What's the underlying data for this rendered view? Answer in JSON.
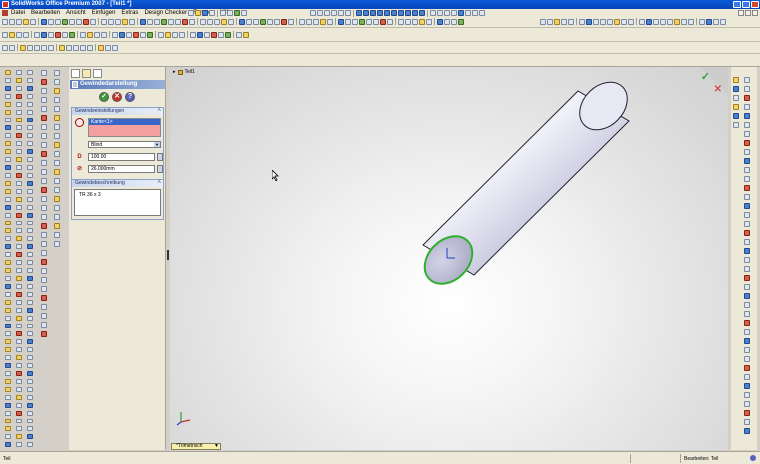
{
  "window": {
    "title": "SolidWorks Office Premium 2007 - [Teil1 *]"
  },
  "menubar": {
    "items": [
      "Datei",
      "Bearbeiten",
      "Ansicht",
      "Einfügen",
      "Extras",
      "Design Checker",
      "Fenster",
      "Hilfe"
    ]
  },
  "property_manager": {
    "header": "Gewindedarstellung",
    "actions": {
      "ok": "✓",
      "cancel": "✕",
      "help": "?"
    },
    "settings": {
      "title": "Gewindeeinstellungen",
      "selection": "Kante<1>",
      "end_condition": "Blind",
      "depth": "100.00",
      "diameter": "26.000mm",
      "depth_icon": "D"
    },
    "description": {
      "title": "Gewindebeschreibung",
      "text": "TR 36 x 3"
    }
  },
  "viewport": {
    "tree_label": "Teil1",
    "view_name": "*Trimetrisch",
    "cylinder_color": "#c8c8e0",
    "edge_highlight_color": "#30b030"
  },
  "statusbar": {
    "left_text": "Teil",
    "right_text": "Bearbeiten: Teil"
  }
}
